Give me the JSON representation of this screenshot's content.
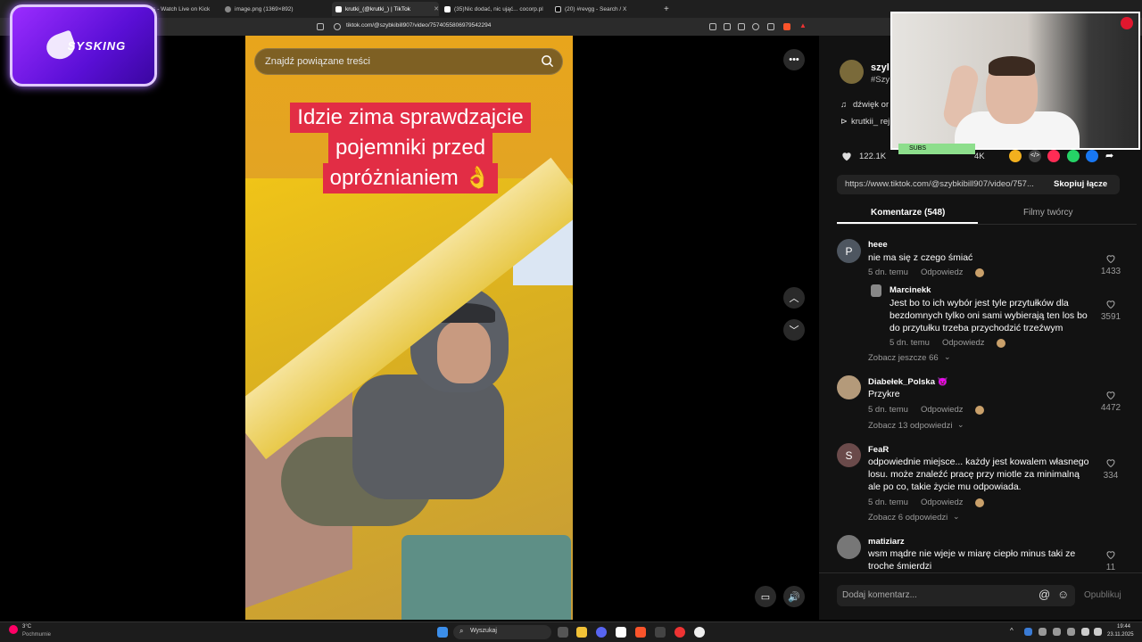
{
  "browser": {
    "tabs": [
      {
        "label": "sN0rth Clips - Watch Live on Kick"
      },
      {
        "label": "image.png (1369×892)"
      },
      {
        "label": "krutki_(@krutki_) | TikTok"
      },
      {
        "label": "(35)Nic dodać, nic ująć... cocorp.pl"
      },
      {
        "label": "(20) #revgg - Search / X"
      }
    ],
    "url": "tiktok.com/@szybkibill907/video/7574055806979542294"
  },
  "overlay": {
    "logo_text": "SYSKING",
    "subs_label": "SUBS"
  },
  "video": {
    "search_placeholder": "Znajdź powiązane treści",
    "caption_lines": [
      "Idzie zima sprawdzajcie",
      "pojemniki przed",
      "opróżnianiem 👌"
    ]
  },
  "author": {
    "name_partial": "szyl",
    "hashtag_partial": "#Szy",
    "music_partial": "dźwięk or",
    "remix_partial": "krutkii_ rej"
  },
  "stats": {
    "likes": "122.1K",
    "shares_partial": "4K"
  },
  "share": {
    "link": "https://www.tiktok.com/@szybkibill907/video/757...",
    "copy_label": "Skopiuj łącze"
  },
  "tabs": {
    "comments": "Komentarze (548)",
    "creator_videos": "Filmy twórcy"
  },
  "comments": [
    {
      "avatar": "P",
      "user": "heee",
      "text": "nie ma się z czego śmiać",
      "time": "5 dn. temu",
      "reply": "Odpowiedz",
      "likes": "1433"
    },
    {
      "user": "Marcinekk",
      "text": "Jest bo to ich wybór jest tyle przytułków dla bezdomnych tylko oni sami wybierają ten los bo do przytułku trzeba przychodzić trzeźwym",
      "time": "5 dn. temu",
      "reply": "Odpowiedz",
      "likes": "3591",
      "more": "Zobacz jeszcze 66"
    },
    {
      "user": "Diabełek_Polska 👿",
      "text": "Przykre",
      "time": "5 dn. temu",
      "reply": "Odpowiedz",
      "likes": "4472",
      "more": "Zobacz 13 odpowiedzi"
    },
    {
      "avatar": "S",
      "user": "FeaR",
      "text": "odpowiednie miejsce... każdy jest kowalem własnego losu. może znaleźć pracę przy miotle za minimalną ale po co, takie życie mu odpowiada.",
      "time": "5 dn. temu",
      "reply": "Odpowiedz",
      "likes": "334",
      "more": "Zobacz 6 odpowiedzi"
    },
    {
      "user": "matiziarz",
      "text": "wsm mądre nie wjeje w miarę ciepło minus taki ze troche śmierdzi",
      "likes": "11"
    }
  ],
  "composer": {
    "placeholder": "Dodaj komentarz...",
    "post_label": "Opublikuj"
  },
  "taskbar": {
    "weather_temp": "3°C",
    "weather_desc": "Pochmurnie",
    "search_label": "Wyszukaj",
    "time": "19:44",
    "date": "23.11.2025"
  },
  "colors": {
    "caption_bg": "#e22d45",
    "panel_bg": "#121212",
    "subs_bg": "#8dde8c"
  }
}
